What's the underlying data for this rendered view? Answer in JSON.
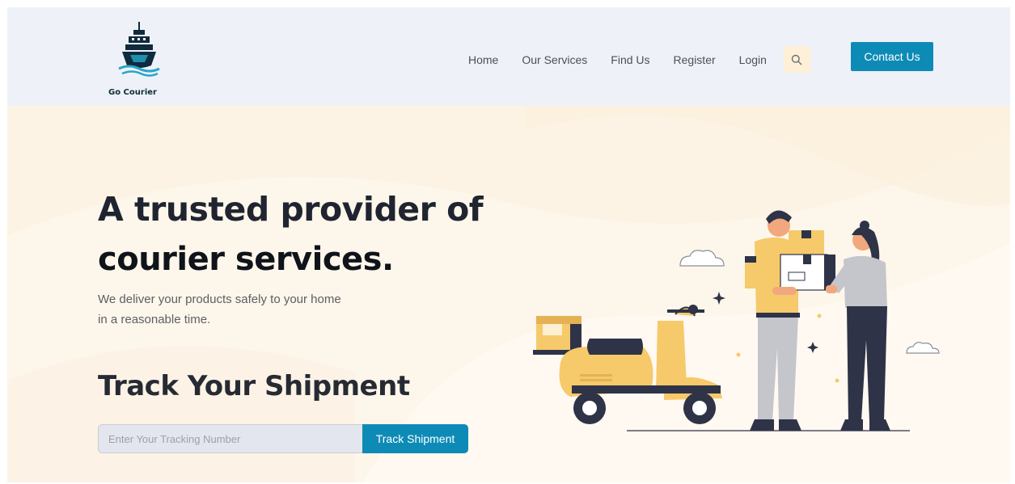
{
  "header": {
    "logo_text": "Go Courier",
    "nav": [
      {
        "label": "Home"
      },
      {
        "label": "Our Services"
      },
      {
        "label": "Find Us"
      },
      {
        "label": "Register"
      },
      {
        "label": "Login"
      }
    ],
    "search_icon": "search-icon",
    "contact_label": "Contact Us"
  },
  "hero": {
    "headline_line1": "A trusted provider of",
    "headline_line2": "courier services.",
    "subtext": "We deliver your products safely to your home in a reasonable time.",
    "track_title": "Track Your Shipment",
    "track_placeholder": "Enter Your Tracking Number",
    "track_value": "",
    "track_button": "Track Shipment"
  },
  "colors": {
    "accent": "#0d8bb6",
    "header_bg": "#eef2f8",
    "hero_bg": "#fdf6ea",
    "illustration_yellow": "#f6c96a",
    "illustration_dark": "#2e3347"
  }
}
